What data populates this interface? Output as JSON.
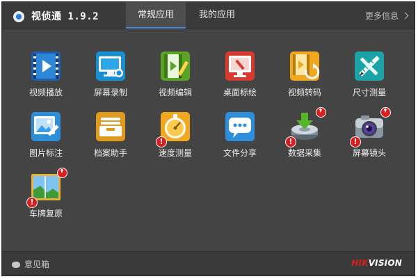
{
  "titlebar": {
    "app_name": "视侦通 1.9.2",
    "tabs": [
      {
        "label": "常规应用",
        "active": true
      },
      {
        "label": "我的应用",
        "active": false
      }
    ],
    "more_label": "更多信息"
  },
  "apps": [
    {
      "label": "视频播放",
      "icon": "video-play-icon"
    },
    {
      "label": "屏幕录制",
      "icon": "screen-record-icon"
    },
    {
      "label": "视频编辑",
      "icon": "video-edit-icon"
    },
    {
      "label": "桌面标绘",
      "icon": "desktop-annotate-icon"
    },
    {
      "label": "视频转码",
      "icon": "video-transcode-icon"
    },
    {
      "label": "尺寸测量",
      "icon": "size-measure-icon"
    },
    {
      "label": "图片标注",
      "icon": "image-annotate-icon"
    },
    {
      "label": "档案助手",
      "icon": "archive-assistant-icon"
    },
    {
      "label": "速度测量",
      "icon": "speed-measure-icon"
    },
    {
      "label": "文件分享",
      "icon": "file-share-icon"
    },
    {
      "label": "数据采集",
      "icon": "data-collect-icon"
    },
    {
      "label": "屏幕镜头",
      "icon": "screen-lens-icon"
    },
    {
      "label": "车牌复原",
      "icon": "plate-restore-icon"
    }
  ],
  "footer": {
    "feedback_label": "意见箱",
    "brand_hik": "HIK",
    "brand_vision": "VISION"
  },
  "colors": {
    "window_bg": "#444444",
    "titlebar_bg": "#3a3a3a",
    "active_tab_underline": "#3d8fe0",
    "badge_red": "#d81e1e"
  }
}
